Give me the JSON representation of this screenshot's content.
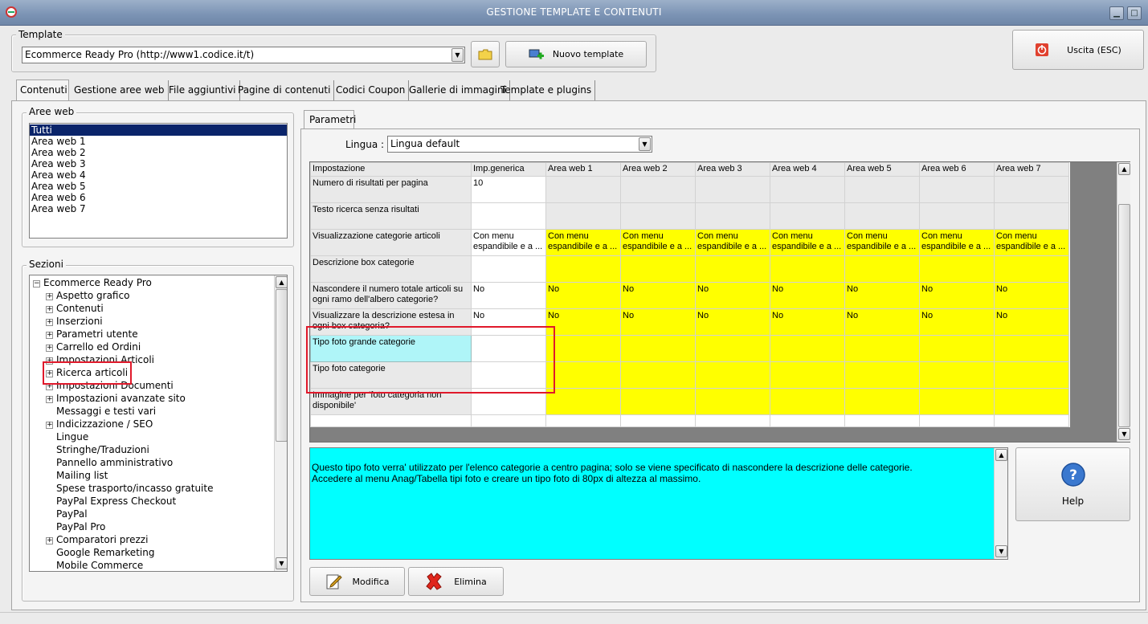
{
  "window": {
    "title": "GESTIONE TEMPLATE E CONTENUTI"
  },
  "template_group": {
    "label": "Template",
    "combo_value": "Ecommerce Ready Pro (http://www1.codice.it/t)",
    "new_template_label": "Nuovo template"
  },
  "exit_button": {
    "label": "Uscita (ESC)"
  },
  "tabs": [
    {
      "label": "Contenuti"
    },
    {
      "label": "Gestione aree web"
    },
    {
      "label": "File aggiuntivi"
    },
    {
      "label": "Pagine di contenuti"
    },
    {
      "label": "Codici Coupon"
    },
    {
      "label": "Gallerie di immagini"
    },
    {
      "label": "Template e plugins"
    }
  ],
  "aree_web": {
    "label": "Aree web",
    "items": [
      "Tutti",
      "Area web 1",
      "Area web 2",
      "Area web 3",
      "Area web 4",
      "Area web 5",
      "Area web 6",
      "Area web 7"
    ],
    "selected": "Tutti"
  },
  "sezioni": {
    "label": "Sezioni",
    "root": "Ecommerce Ready Pro",
    "items": [
      {
        "label": "Aspetto grafico",
        "expandable": true
      },
      {
        "label": "Contenuti",
        "expandable": true
      },
      {
        "label": "Inserzioni",
        "expandable": true
      },
      {
        "label": "Parametri utente",
        "expandable": true
      },
      {
        "label": "Carrello ed Ordini",
        "expandable": true
      },
      {
        "label": "Impostazioni Articoli",
        "expandable": true
      },
      {
        "label": "Ricerca articoli",
        "expandable": true
      },
      {
        "label": "Impostazioni Documenti",
        "expandable": true
      },
      {
        "label": "Impostazioni avanzate sito",
        "expandable": true
      },
      {
        "label": "Messaggi e testi vari",
        "expandable": false
      },
      {
        "label": "Indicizzazione / SEO",
        "expandable": true
      },
      {
        "label": "Lingue",
        "expandable": false
      },
      {
        "label": "Stringhe/Traduzioni",
        "expandable": false
      },
      {
        "label": "Pannello amministrativo",
        "expandable": false
      },
      {
        "label": "Mailing list",
        "expandable": false
      },
      {
        "label": "Spese trasporto/incasso gratuite",
        "expandable": false
      },
      {
        "label": "PayPal Express Checkout",
        "expandable": false
      },
      {
        "label": "PayPal",
        "expandable": false
      },
      {
        "label": "PayPal Pro",
        "expandable": false
      },
      {
        "label": "Comparatori prezzi",
        "expandable": true
      },
      {
        "label": "Google Remarketing",
        "expandable": false
      },
      {
        "label": "Mobile Commerce",
        "expandable": false
      }
    ]
  },
  "parametri": {
    "tab_label": "Parametri",
    "lingua_label": "Lingua :",
    "lingua_value": "Lingua default",
    "columns": [
      "Impostazione",
      "Imp.generica",
      "Area web 1",
      "Area web 2",
      "Area web 3",
      "Area web 4",
      "Area web 5",
      "Area web 6",
      "Area web 7"
    ],
    "rows": [
      {
        "label": "Numero di risultati per pagina",
        "generic": "10",
        "areas": [
          "",
          "",
          "",
          "",
          "",
          "",
          ""
        ],
        "style": "gray"
      },
      {
        "label": "Testo ricerca senza risultati",
        "generic": "",
        "areas": [
          "",
          "",
          "",
          "",
          "",
          "",
          ""
        ],
        "style": "gray"
      },
      {
        "label": "Visualizzazione categorie articoli",
        "generic": "Con menu espandibile e a ...",
        "areas": [
          "Con menu espandibile e a ...",
          "Con menu espandibile e a ...",
          "Con menu espandibile e a ...",
          "Con menu espandibile e a ...",
          "Con menu espandibile e a ...",
          "Con menu espandibile e a ...",
          "Con menu espandibile e a ..."
        ],
        "style": "yellow"
      },
      {
        "label": "Descrizione box categorie",
        "generic": "",
        "areas": [
          "",
          "",
          "",
          "",
          "",
          "",
          ""
        ],
        "style": "yellow"
      },
      {
        "label": "Nascondere il numero totale articoli su ogni ramo dell'albero categorie?",
        "generic": "No",
        "areas": [
          "No",
          "No",
          "No",
          "No",
          "No",
          "No",
          "No"
        ],
        "style": "yellow"
      },
      {
        "label": "Visualizzare la descrizione estesa in ogni box categoria?",
        "generic": "No",
        "areas": [
          "No",
          "No",
          "No",
          "No",
          "No",
          "No",
          "No"
        ],
        "style": "yellow"
      },
      {
        "label": "Tipo foto grande categorie",
        "generic": "",
        "areas": [
          "",
          "",
          "",
          "",
          "",
          "",
          ""
        ],
        "style": "yellow"
      },
      {
        "label": "Tipo foto categorie",
        "generic": "",
        "areas": [
          "",
          "",
          "",
          "",
          "",
          "",
          ""
        ],
        "style": "yellow"
      },
      {
        "label": "Immagine per 'foto categoria non disponibile'",
        "generic": "",
        "areas": [
          "",
          "",
          "",
          "",
          "",
          "",
          ""
        ],
        "style": "yellow"
      },
      {
        "label": "",
        "generic": "",
        "areas": [
          "",
          "",
          "",
          "",
          "",
          "",
          ""
        ],
        "style": "white"
      }
    ],
    "selected_row_label": "Tipo foto grande categorie",
    "description": "Questo tipo foto verra' utilizzato per l'elenco categorie a centro pagina; solo se viene specificato di nascondere la descrizione delle categorie.\nAccedere al menu Anag/Tabella tipi foto e creare un tipo foto di 80px di altezza al massimo.",
    "help_label": "Help",
    "modifica_label": "Modifica",
    "elimina_label": "Elimina"
  },
  "colors": {
    "yellow_cells": "#ffff00",
    "selected_cell": "#aff5f8",
    "description_bg": "#00ffff",
    "highlight_border": "#e0192b",
    "list_selection": "#0a246a"
  }
}
